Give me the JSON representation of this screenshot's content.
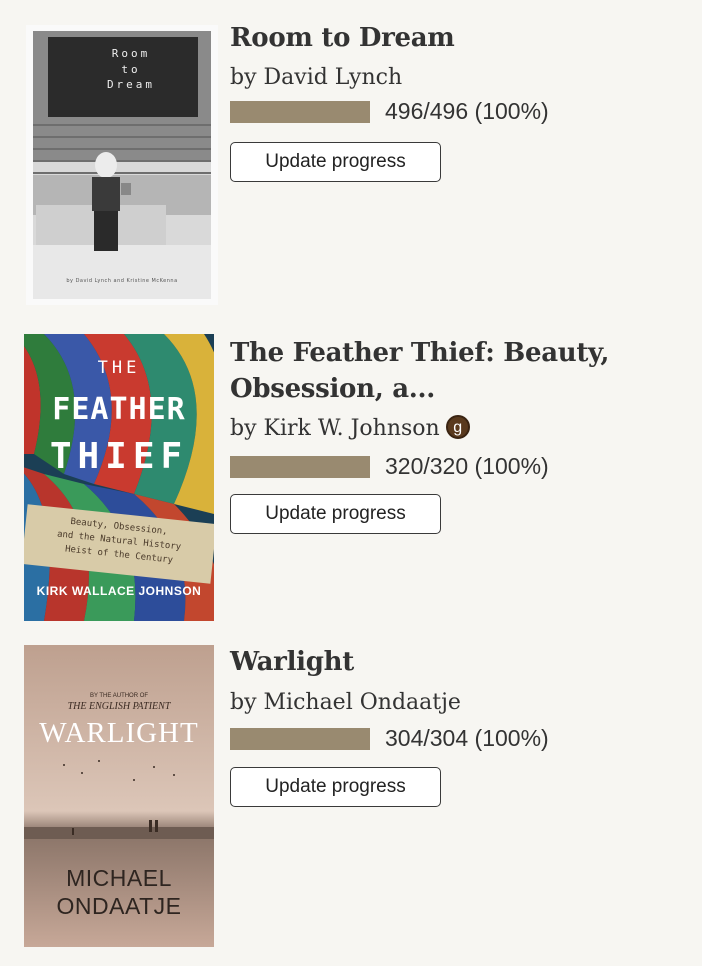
{
  "books": [
    {
      "title": "Room to Dream",
      "author_prefix": "by",
      "author": "David Lynch",
      "progress_fraction": 1.0,
      "progress_text": "496/496 (100%)",
      "button_label": "Update progress",
      "cover": {
        "line1": "Room",
        "line2": "to",
        "line3": "Dream",
        "footer": "by David Lynch and Kristine McKenna"
      }
    },
    {
      "title": "The Feather Thief: Beauty, Obsession, a...",
      "author_prefix": "by",
      "author": "Kirk W. Johnson",
      "badge": "g",
      "progress_fraction": 1.0,
      "progress_text": "320/320 (100%)",
      "button_label": "Update progress",
      "cover": {
        "line1": "THE",
        "line2": "FEATHER",
        "line3": "THIEF",
        "sub1": "Beauty, Obsession,",
        "sub2": "and the Natural History",
        "sub3": "Heist of the Century",
        "footer": "KIRK WALLACE JOHNSON"
      }
    },
    {
      "title": "Warlight",
      "author_prefix": "by",
      "author": "Michael Ondaatje",
      "progress_fraction": 1.0,
      "progress_text": "304/304 (100%)",
      "button_label": "Update progress",
      "cover": {
        "top1": "BY THE AUTHOR OF",
        "top2": "THE ENGLISH PATIENT",
        "title": "WARLIGHT",
        "author1": "MICHAEL",
        "author2": "ONDAATJE"
      }
    }
  ],
  "colors": {
    "background": "#f7f6f2",
    "progress_fill": "#998a70",
    "badge": "#5a3a1e"
  }
}
